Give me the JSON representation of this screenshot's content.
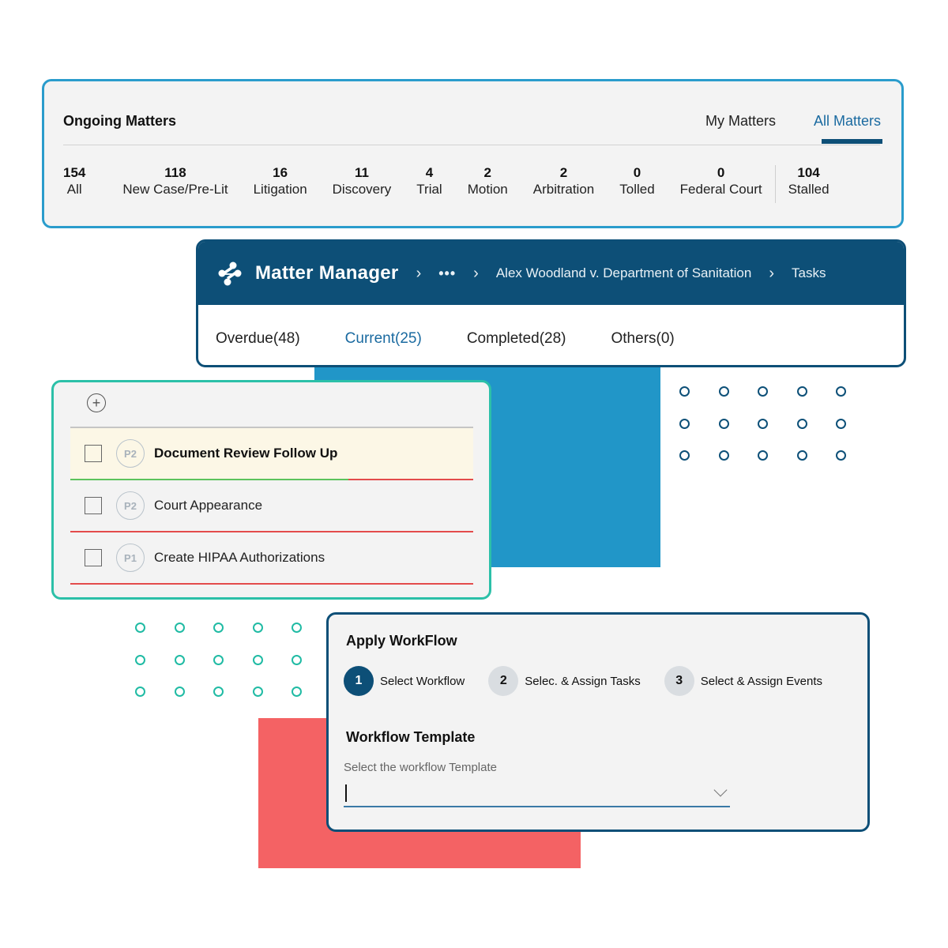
{
  "colors": {
    "brand_dark": "#0d4f77",
    "accent_blue": "#2196c8",
    "accent_teal": "#2cc0a8",
    "accent_red": "#f46264",
    "active_link": "#1a6aa0",
    "progress_green": "#5cc35c",
    "overdue_red": "#e34b4b"
  },
  "ongoing": {
    "title": "Ongoing Matters",
    "tabs": [
      {
        "label": "My Matters",
        "active": false
      },
      {
        "label": "All Matters",
        "active": true
      }
    ],
    "stats": [
      {
        "count": "154",
        "label": "All"
      },
      {
        "count": "118",
        "label": "New Case/Pre-Lit"
      },
      {
        "count": "16",
        "label": "Litigation"
      },
      {
        "count": "11",
        "label": "Discovery"
      },
      {
        "count": "4",
        "label": "Trial"
      },
      {
        "count": "2",
        "label": "Motion"
      },
      {
        "count": "2",
        "label": "Arbitration"
      },
      {
        "count": "0",
        "label": "Tolled"
      },
      {
        "count": "0",
        "label": "Federal Court"
      },
      {
        "count": "104",
        "label": "Stalled"
      }
    ]
  },
  "manager": {
    "logo_icon": "molecule-logo-icon",
    "app_title": "Matter Manager",
    "breadcrumb": {
      "separator": "›",
      "more": "•••",
      "matter": "Alex Woodland v. Department of Sanitation",
      "current": "Tasks"
    },
    "tabs": [
      {
        "label": "Overdue(48)",
        "active": false
      },
      {
        "label": "Current(25)",
        "active": true
      },
      {
        "label": "Completed(28)",
        "active": false
      },
      {
        "label": "Others(0)",
        "active": false
      }
    ]
  },
  "tasks": {
    "add_icon": "plus-circle-icon",
    "add_symbol": "+",
    "items": [
      {
        "priority": "P2",
        "name": "Document Review Follow Up",
        "checked": false,
        "highlighted": true,
        "progress": 0.69
      },
      {
        "priority": "P2",
        "name": "Court Appearance",
        "checked": false,
        "highlighted": false
      },
      {
        "priority": "P1",
        "name": "Create HIPAA Authorizations",
        "checked": false,
        "highlighted": false
      }
    ]
  },
  "workflow": {
    "title": "Apply WorkFlow",
    "steps": [
      {
        "number": "1",
        "label": "Select Workflow",
        "active": true
      },
      {
        "number": "2",
        "label": "Selec. & Assign Tasks",
        "active": false
      },
      {
        "number": "3",
        "label": "Select & Assign Events",
        "active": false
      }
    ],
    "template_heading": "Workflow Template",
    "field_label": "Select the workflow Template",
    "field_value": "",
    "chevron_icon": "chevron-down-icon"
  }
}
